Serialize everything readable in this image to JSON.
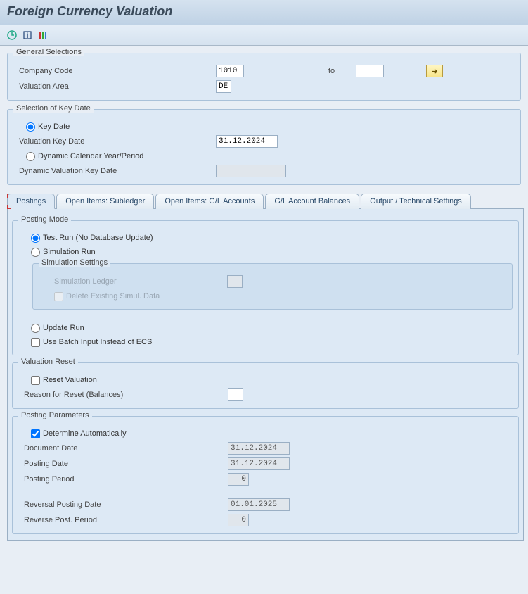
{
  "title": "Foreign Currency Valuation",
  "toolbar_icons": [
    "execute",
    "info",
    "variant"
  ],
  "general": {
    "title": "General Selections",
    "company_code_label": "Company Code",
    "company_code_value": "1010",
    "to_label": "to",
    "company_code_to_value": "",
    "valuation_area_label": "Valuation Area",
    "valuation_area_value": "DE"
  },
  "keydate": {
    "title": "Selection of Key Date",
    "radio_keydate": "Key Date",
    "valuation_keydate_label": "Valuation Key Date",
    "valuation_keydate_value": "31.12.2024",
    "radio_dynamic": "Dynamic Calendar Year/Period",
    "dynamic_valuation_keydate_label": "Dynamic Valuation Key Date",
    "dynamic_valuation_keydate_value": ""
  },
  "tabs": [
    "Postings",
    "Open Items: Subledger",
    "Open Items: G/L Accounts",
    "G/L Account Balances",
    "Output / Technical Settings"
  ],
  "posting_mode": {
    "title": "Posting Mode",
    "radio_test": "Test Run (No Database Update)",
    "radio_sim": "Simulation Run",
    "sim_settings_title": "Simulation Settings",
    "sim_ledger_label": "Simulation Ledger",
    "sim_ledger_value": "",
    "chk_delete_sim": "Delete Existing Simul. Data",
    "radio_update": "Update Run",
    "chk_batch": "Use Batch Input Instead of ECS"
  },
  "valuation_reset": {
    "title": "Valuation Reset",
    "chk_reset": "Reset Valuation",
    "reason_label": "Reason for Reset (Balances)",
    "reason_value": ""
  },
  "posting_params": {
    "title": "Posting Parameters",
    "chk_auto": "Determine Automatically",
    "doc_date_label": "Document Date",
    "doc_date_value": "31.12.2024",
    "posting_date_label": "Posting Date",
    "posting_date_value": "31.12.2024",
    "posting_period_label": "Posting Period",
    "posting_period_value": "0",
    "reversal_date_label": "Reversal Posting Date",
    "reversal_date_value": "01.01.2025",
    "reverse_period_label": "Reverse Post. Period",
    "reverse_period_value": "0"
  }
}
